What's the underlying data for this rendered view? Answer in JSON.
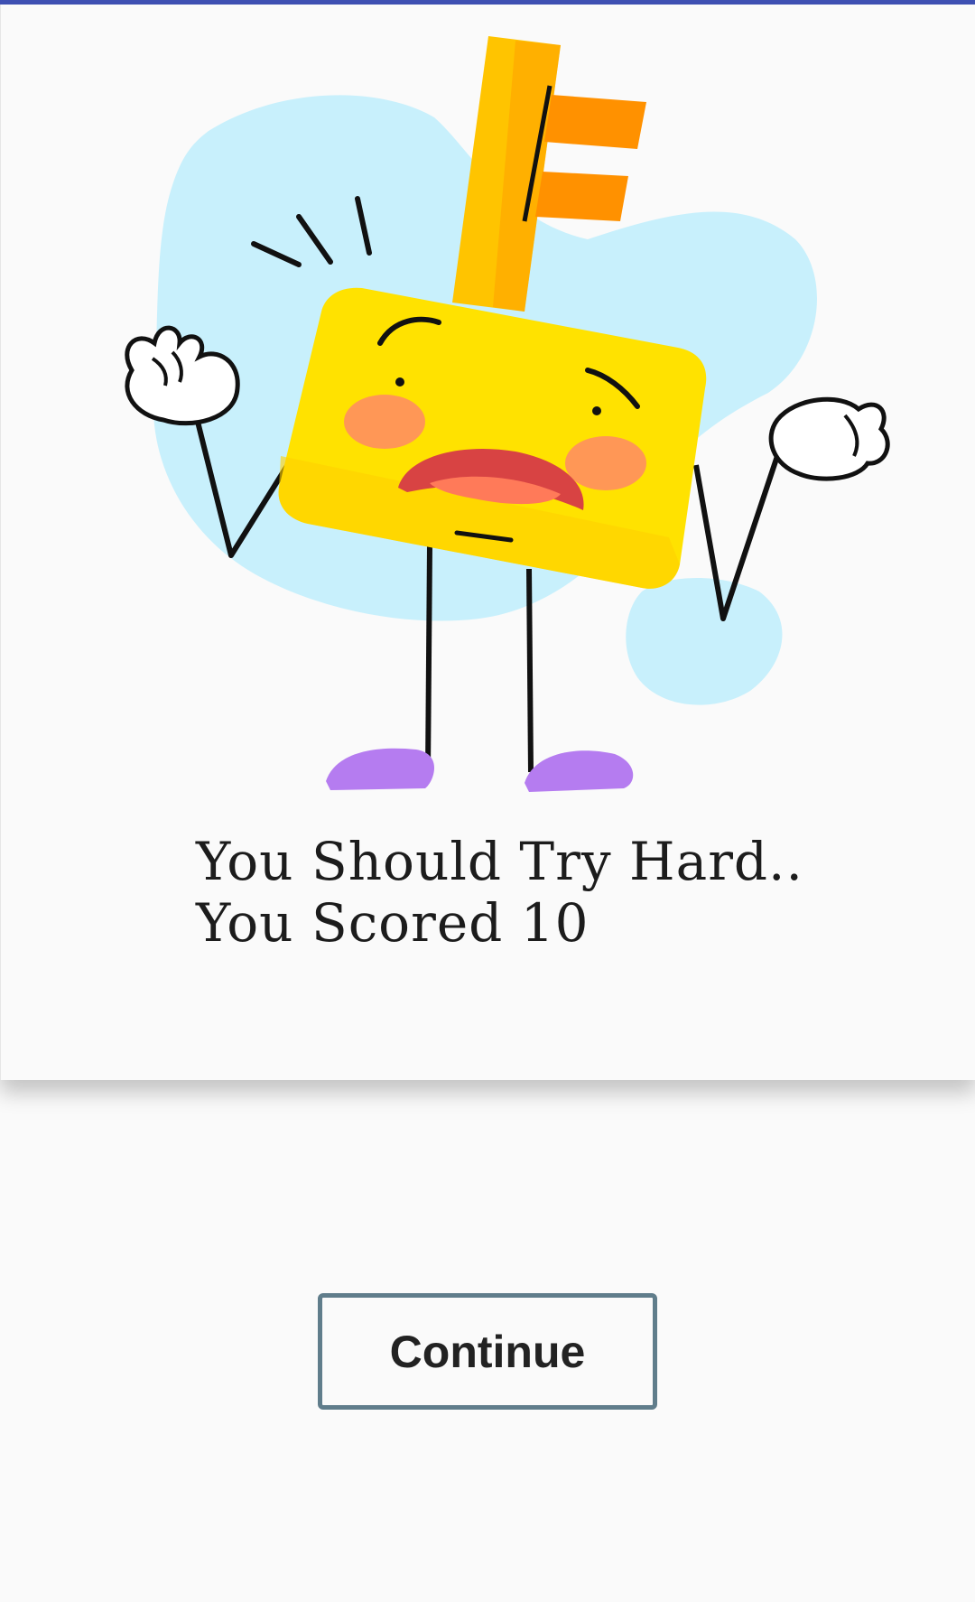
{
  "result": {
    "message_line1": "You Should Try Hard..",
    "message_line2": "You Scored 10"
  },
  "illustration": {
    "icon": "sad-key-character-icon"
  },
  "actions": {
    "continue_label": "Continue"
  },
  "colors": {
    "accent_bar": "#3f51b5",
    "button_border": "#607d8b",
    "key_yellow": "#ffe200",
    "key_orange": "#ffa000",
    "blob_blue": "#c8f0fc",
    "shoe_purple": "#b57cf0"
  }
}
